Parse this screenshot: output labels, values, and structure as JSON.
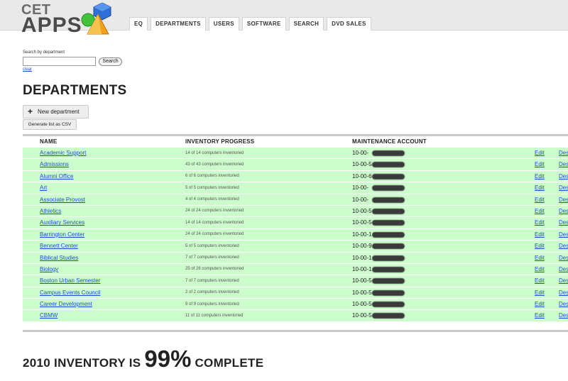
{
  "app": {
    "logo_top": "CET",
    "logo_bottom": "APPS"
  },
  "nav": {
    "tabs": [
      {
        "label": "EQ"
      },
      {
        "label": "DEPARTMENTS"
      },
      {
        "label": "USERS"
      },
      {
        "label": "SOFTWARE"
      },
      {
        "label": "SEARCH"
      },
      {
        "label": "DVD SALES"
      }
    ]
  },
  "search": {
    "label": "Search by department",
    "value": "",
    "button_label": "Search",
    "clear_label": "clear"
  },
  "page": {
    "title": "DEPARTMENTS"
  },
  "actions": {
    "new_label": "New department",
    "csv_label": "Generate list as CSV"
  },
  "table": {
    "headers": {
      "name": "NAME",
      "progress": "INVENTORY PROGRESS",
      "account": "MAINTENANCE ACCOUNT"
    },
    "edit_label": "Edit",
    "destroy_label": "Des",
    "rows": [
      {
        "name": "Academic Support",
        "progress": "14 of 14 computers inventoried",
        "account": "10-00-"
      },
      {
        "name": "Admissions",
        "progress": "43 of 43 computers inventoried",
        "account": "10-00-5"
      },
      {
        "name": "Alumni Office",
        "progress": "6 of 6 computers inventoried",
        "account": "10-00-6"
      },
      {
        "name": "Art",
        "progress": "5 of 5 computers inventoried",
        "account": "10-00-"
      },
      {
        "name": "Associate Provost",
        "progress": "4 of 4 computers inventoried",
        "account": "10-00-"
      },
      {
        "name": "Athletics",
        "progress": "24 of 24 computers inventoried",
        "account": "10-00-5"
      },
      {
        "name": "Auxiliary Services",
        "progress": "14 of 14 computers inventoried",
        "account": "10-00-5"
      },
      {
        "name": "Barrington Center",
        "progress": "24 of 24 computers inventoried",
        "account": "10-00-1"
      },
      {
        "name": "Bennett Center",
        "progress": "5 of 5 computers inventoried",
        "account": "10-00-9"
      },
      {
        "name": "Biblical Studies",
        "progress": "7 of 7 computers inventoried",
        "account": "10-00-1"
      },
      {
        "name": "Biology",
        "progress": "25 of 26 computers inventoried",
        "account": "10-00-1"
      },
      {
        "name": "Boston Urban Semester",
        "progress": "7 of 7 computers inventoried",
        "account": "10-00-5"
      },
      {
        "name": "Campus Events Council",
        "progress": "2 of 2 computers inventoried",
        "account": "10-00-5"
      },
      {
        "name": "Career Development",
        "progress": "9 of 9 computers inventoried",
        "account": "10-00-5"
      },
      {
        "name": "CBMW",
        "progress": "11 of 11 computers inventoried",
        "account": "10-00-5"
      }
    ]
  },
  "summary": {
    "prefix": "2010 INVENTORY IS",
    "percent": "99%",
    "suffix": "COMPLETE"
  }
}
